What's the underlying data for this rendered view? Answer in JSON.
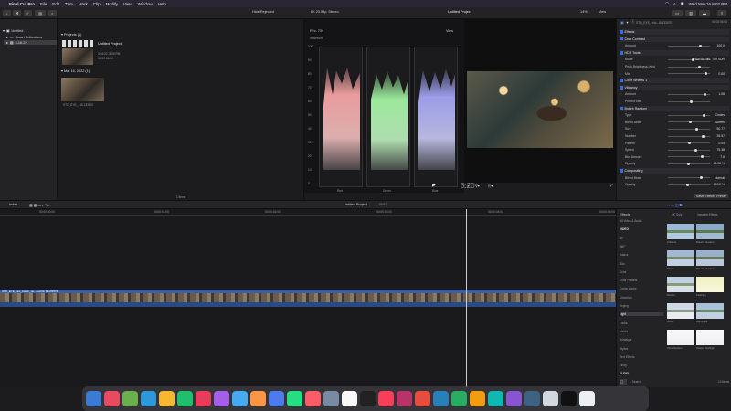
{
  "menubar": {
    "app": "Final Cut Pro",
    "items": [
      "File",
      "Edit",
      "Trim",
      "Mark",
      "Clip",
      "Modify",
      "View",
      "Window",
      "Help"
    ],
    "datetime": "Wed Mar 16 8:02 PM"
  },
  "toolbar": {
    "hide_rejected": "Hide Rejected",
    "format": "8K 23.98p, Stereo",
    "project_title": "Untitled Project",
    "zoom": "14%",
    "view": "View"
  },
  "sidebar": {
    "items": [
      {
        "label": "Untitled"
      },
      {
        "label": "Smart Collections"
      },
      {
        "label": "3-16-22"
      }
    ]
  },
  "browser": {
    "projects_header": "Projects",
    "projects_count": "(1)",
    "project_name": "Untitled Project",
    "project_date": "3/16/22, 8:00 PM",
    "project_duration": "00:00:06:01",
    "event_header": "Mar 16, 2022",
    "event_count": "(1)",
    "clip_name": "STO_EYE_...8i-133570",
    "items_count": "1 items"
  },
  "scopes": {
    "title": "Rec. 709",
    "view": "View",
    "type": "Waveform",
    "scale": [
      "100",
      "90",
      "80",
      "70",
      "60",
      "50",
      "40",
      "30",
      "20",
      "10",
      "0"
    ],
    "channels": [
      "Red",
      "Green",
      "Blue"
    ]
  },
  "viewer": {
    "timecode": "6:20",
    "play_symbol": "▶"
  },
  "inspector": {
    "clip_name": "STO_EYE_velo...8i-133570",
    "duration": "00:00:06:01",
    "sections": [
      {
        "label": "Effects",
        "type": "head"
      },
      {
        "label": "Crop Contrast",
        "type": "head"
      },
      {
        "label": "Amount",
        "value": "100.0",
        "type": "row"
      },
      {
        "label": "HDR Tools",
        "type": "head"
      },
      {
        "label": "Mode",
        "value": "HDR to Rec. 709 SDR",
        "type": "row"
      },
      {
        "label": "Peak Brightness (nits)",
        "value": "",
        "type": "row"
      },
      {
        "label": "Mix",
        "value": "0.00",
        "type": "row"
      },
      {
        "label": "Color Wheels 1",
        "type": "head"
      },
      {
        "label": "Vibrancy",
        "type": "head"
      },
      {
        "label": "Amount",
        "value": "1.08",
        "type": "row"
      },
      {
        "label": "Protect Skin",
        "value": "",
        "type": "row"
      },
      {
        "label": "Bokeh Random",
        "type": "head"
      },
      {
        "label": "Type",
        "value": "Circles",
        "type": "row"
      },
      {
        "label": "Blend Mode",
        "value": "Screen",
        "type": "row"
      },
      {
        "label": "Size",
        "value": "50.77",
        "type": "row"
      },
      {
        "label": "Number",
        "value": "39.57",
        "type": "row"
      },
      {
        "label": "Pattern",
        "value": "0.04",
        "type": "row"
      },
      {
        "label": "Speed",
        "value": "75.38",
        "type": "row"
      },
      {
        "label": "Blur Amount",
        "value": "7.6",
        "type": "row"
      },
      {
        "label": "Opacity",
        "value": "60.06 %",
        "type": "row"
      },
      {
        "label": "Compositing",
        "type": "head"
      },
      {
        "label": "Blend Mode",
        "value": "Normal",
        "type": "row"
      },
      {
        "label": "Opacity",
        "value": "100.0 %",
        "type": "row"
      }
    ],
    "save_button": "Save Effects Preset"
  },
  "timeline_bar": {
    "index": "Index",
    "project": "Untitled Project",
    "duration": "00:01"
  },
  "timeline": {
    "clip_label": "STO_EYE_raw_bokeh_de...ouchlin 8i-133570",
    "timecodes": [
      "00:00:00:00",
      "00:00:01:00",
      "00:00:02:00",
      "00:00:03:00",
      "00:00:04:00",
      "00:00:05:00"
    ]
  },
  "effects_browser": {
    "title": "Effects",
    "filters": [
      "4K Only",
      "Installed Effects"
    ],
    "categories": [
      "All Video & Audio",
      "VIDEO",
      "All",
      "360°",
      "Basics",
      "Blur",
      "Color",
      "Color Presets",
      "Comic Looks",
      "Distortion",
      "Keying",
      "Light",
      "Looks",
      "Masks",
      "Nostalgia",
      "Stylize",
      "Text Effects",
      "Tiling",
      "AUDIO"
    ],
    "selected_category": "Light",
    "items": [
      {
        "name": "Artifacts"
      },
      {
        "name": "Bokeh Random"
      },
      {
        "name": "Bloom"
      },
      {
        "name": "Bokeh Random"
      },
      {
        "name": "Dazzle"
      },
      {
        "name": "Flashing"
      },
      {
        "name": "Glow"
      },
      {
        "name": "Highlights"
      },
      {
        "name": "Ultra Flashes"
      },
      {
        "name": "Space Flashlight"
      }
    ],
    "search_placeholder": "Search",
    "count": "10 items"
  }
}
